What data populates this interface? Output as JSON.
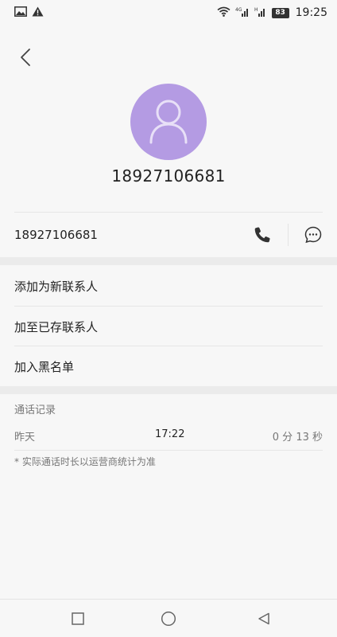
{
  "status_bar": {
    "battery": "83",
    "time": "19:25",
    "icons": [
      "image-icon",
      "warning-icon",
      "wifi-icon",
      "signal-4g-icon",
      "signal-icon",
      "battery-icon"
    ]
  },
  "contact": {
    "header_number": "18927106681",
    "row_number": "18927106681",
    "avatar_color": "#b49be3"
  },
  "actions": [
    {
      "label": "添加为新联系人"
    },
    {
      "label": "加至已存联系人"
    },
    {
      "label": "加入黑名单"
    }
  ],
  "call_log": {
    "title": "通话记录",
    "entries": [
      {
        "day": "昨天",
        "time": "17:22",
        "duration": "0 分 13 秒"
      }
    ],
    "note": "* 实际通话时长以运营商统计为准"
  },
  "nav": {
    "buttons": [
      "recents-icon",
      "home-icon",
      "back-icon"
    ]
  }
}
